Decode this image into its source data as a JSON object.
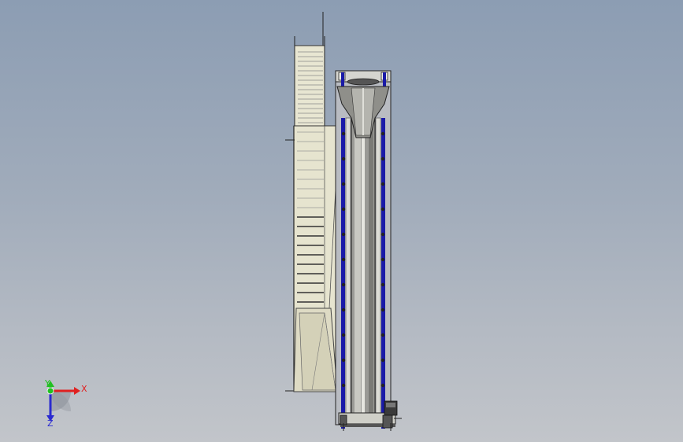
{
  "triad": {
    "x_label": "X",
    "y_label": "Y",
    "z_label": "Z",
    "x_color": "#e02020",
    "y_color": "#22c022",
    "z_color": "#2a2ad0"
  },
  "colors": {
    "background_top": "#8c9db3",
    "background_bottom": "#c2c5ca",
    "panel_fill": "#e8e6d2",
    "blue_rail": "#1a1aa8",
    "drum_fill": "#9a9a96"
  }
}
